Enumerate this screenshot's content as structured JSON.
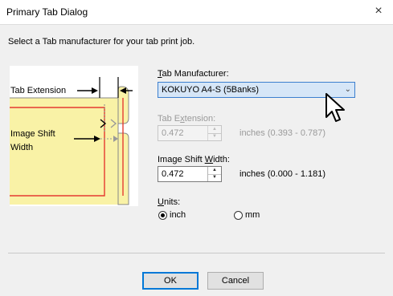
{
  "dialog": {
    "title": "Primary Tab Dialog",
    "close_symbol": "×"
  },
  "instruction": "Select a Tab manufacturer for your tab print job.",
  "illustration": {
    "tab_extension_label": "Tab Extension",
    "image_shift_label_line1": "Image Shift",
    "image_shift_label_line2": "Width",
    "colors": {
      "tab_fill": "#f9f2a6",
      "red_line": "#e53a30",
      "tab_border": "#888888"
    }
  },
  "tab_manufacturer": {
    "label_mnemonic": "T",
    "label_rest": "ab Manufacturer:",
    "value": "KOKUYO A4-S (5Banks)"
  },
  "tab_extension": {
    "label_pre": "Tab E",
    "label_mnemonic": "x",
    "label_post": "tension:",
    "value": "0.472",
    "range": "inches (0.393 - 0.787)"
  },
  "image_shift_width": {
    "label_pre": "Image Shift ",
    "label_mnemonic": "W",
    "label_post": "idth:",
    "value": "0.472",
    "range": "inches (0.000 - 1.181)"
  },
  "units": {
    "label_mnemonic": "U",
    "label_rest": "nits:",
    "options": [
      {
        "label": "inch",
        "selected": true
      },
      {
        "label": "mm",
        "selected": false
      }
    ]
  },
  "buttons": {
    "ok": "OK",
    "cancel": "Cancel"
  }
}
